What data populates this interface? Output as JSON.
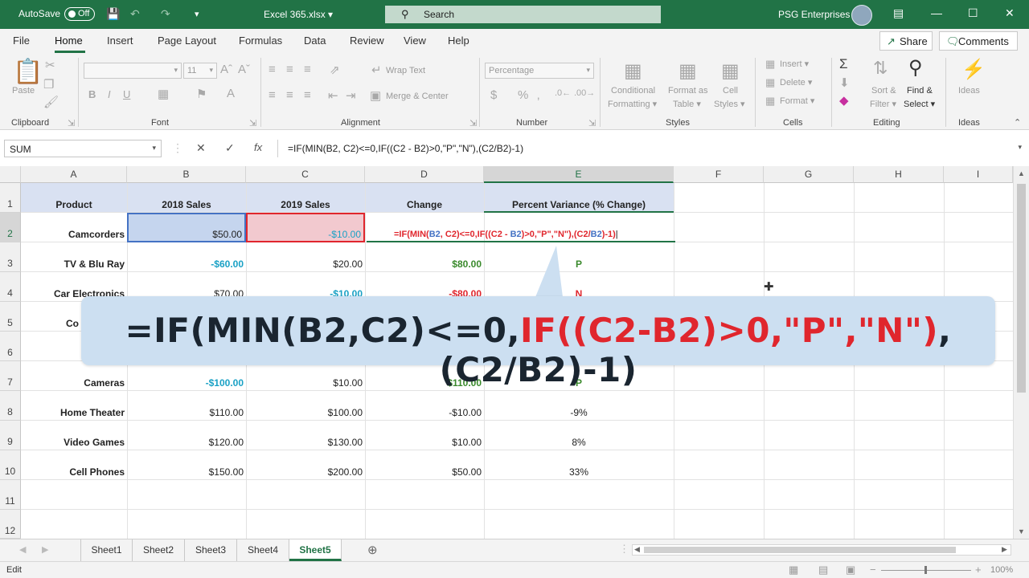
{
  "titlebar": {
    "autosave_label": "AutoSave",
    "autosave_state": "Off",
    "filename": "Excel 365.xlsx",
    "search_placeholder": "Search",
    "user_name": "PSG Enterprises"
  },
  "menu": {
    "tabs": [
      "File",
      "Home",
      "Insert",
      "Page Layout",
      "Formulas",
      "Data",
      "Review",
      "View",
      "Help"
    ],
    "active_tab": "Home",
    "share_label": "Share",
    "comments_label": "Comments"
  },
  "ribbon": {
    "clipboard": {
      "paste": "Paste",
      "group": "Clipboard"
    },
    "font": {
      "size": "11",
      "group": "Font"
    },
    "alignment": {
      "wrap_text": "Wrap Text",
      "merge_center": "Merge & Center",
      "group": "Alignment"
    },
    "number": {
      "format": "Percentage",
      "group": "Number"
    },
    "styles": {
      "conditional_1": "Conditional",
      "conditional_2": "Formatting",
      "format_table_1": "Format as",
      "format_table_2": "Table",
      "cell_styles_1": "Cell",
      "cell_styles_2": "Styles",
      "group": "Styles"
    },
    "cells": {
      "insert": "Insert",
      "delete": "Delete",
      "format": "Format",
      "group": "Cells"
    },
    "editing": {
      "sort_1": "Sort &",
      "sort_2": "Filter",
      "find_1": "Find &",
      "find_2": "Select",
      "group": "Editing"
    },
    "ideas": {
      "ideas": "Ideas",
      "group": "Ideas"
    }
  },
  "formula_bar": {
    "name_box": "SUM",
    "formula": "=IF(MIN(B2, C2)<=0,IF((C2 - B2)>0,\"P\",\"N\"),(C2/B2)-1)"
  },
  "grid": {
    "columns": [
      "A",
      "B",
      "C",
      "D",
      "E",
      "F",
      "G",
      "H",
      "I"
    ],
    "rows": [
      "1",
      "2",
      "3",
      "4",
      "5",
      "6",
      "7",
      "8",
      "9",
      "10",
      "11",
      "12"
    ],
    "headers": {
      "a": "Product",
      "b": "2018  Sales",
      "c": "2019 Sales",
      "d": "Change",
      "e": "Percent Variance  (% Change)"
    },
    "r2": {
      "a": "Camcorders",
      "b": "$50.00",
      "c": "-$10.00"
    },
    "r3": {
      "a": "TV & Blu Ray",
      "b": "-$60.00",
      "c": "$20.00",
      "d": "$80.00",
      "e": "P"
    },
    "r4": {
      "a": "Car Electronics",
      "b": "$70.00",
      "c": "-$10.00",
      "d": "-$80.00",
      "e": "N"
    },
    "r5": {
      "a": "Co"
    },
    "r7": {
      "a": "Cameras",
      "b": "-$100.00",
      "c": "$10.00",
      "d": "$110.00",
      "e": "P"
    },
    "r8": {
      "a": "Home Theater",
      "b": "$110.00",
      "c": "$100.00",
      "d": "-$10.00",
      "e": "-9%"
    },
    "r9": {
      "a": "Video Games",
      "b": "$120.00",
      "c": "$130.00",
      "d": "$10.00",
      "e": "8%"
    },
    "r10": {
      "a": "Cell Phones",
      "b": "$150.00",
      "c": "$200.00",
      "d": "$50.00",
      "e": "33%"
    },
    "edit": {
      "p1": "=IF(MIN(",
      "p2": "B2",
      "p3": ", ",
      "p4": "C2",
      "p5": ")<=0,IF((",
      "p6": "C2",
      "p7": " - ",
      "p8": "B2",
      "p9": ")>0,\"P\",\"N\"),(",
      "p10": "C2",
      "p11": "/",
      "p12": "B2",
      "p13": ")-1)"
    }
  },
  "sheets": {
    "tabs": [
      "Sheet1",
      "Sheet2",
      "Sheet3",
      "Sheet4",
      "Sheet5"
    ],
    "active": "Sheet5"
  },
  "status": {
    "mode": "Edit",
    "zoom": "100%"
  },
  "callout": {
    "part1": "=IF(MIN(B2,C2)<=0,",
    "part2": "IF((C2-B2)>0,\"P\",\"N\")",
    "part3": ",(C2/B2)-1)"
  },
  "colors": {
    "excel_green": "#217346",
    "ref_blue": "#4472c4",
    "ref_red": "#e0262d",
    "teal": "#1aa1c5",
    "green_value": "#3a8a2c"
  }
}
